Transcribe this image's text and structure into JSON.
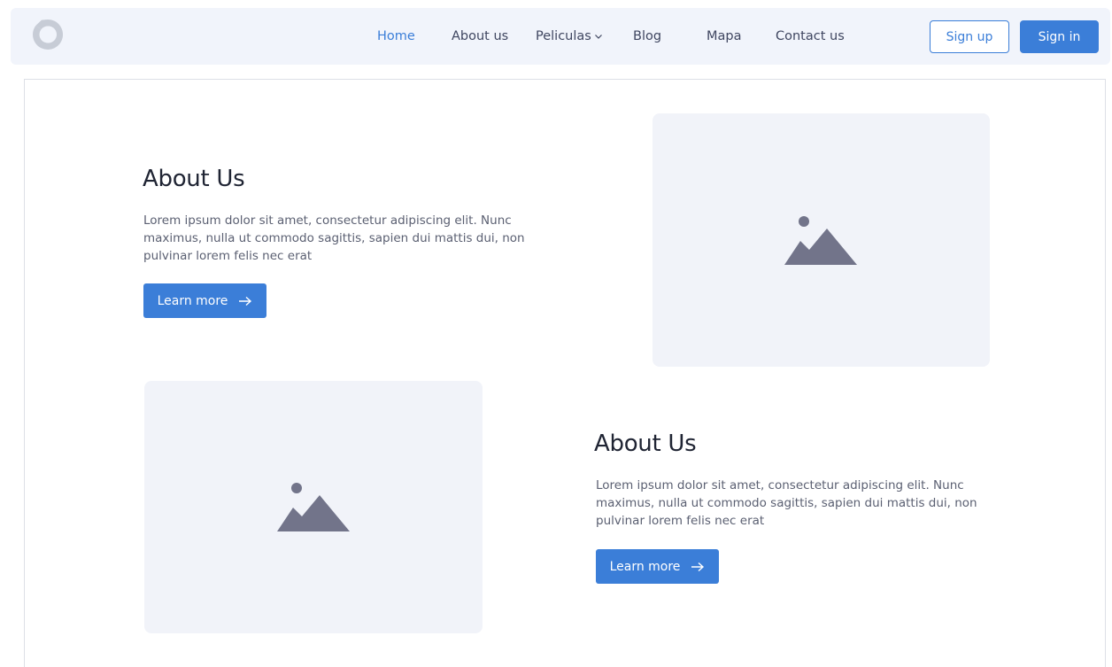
{
  "nav": {
    "links": [
      {
        "label": "Home",
        "active": true
      },
      {
        "label": "About us"
      },
      {
        "label": "Peliculas",
        "dropdown": true
      },
      {
        "label": "Blog"
      },
      {
        "label": "Mapa"
      },
      {
        "label": "Contact us"
      }
    ],
    "signup_label": "Sign up",
    "signin_label": "Sign in"
  },
  "sections": [
    {
      "title": "About Us",
      "body": "Lorem ipsum dolor sit amet, consectetur adipiscing elit. Nunc maximus, nulla ut commodo sagittis, sapien dui mattis dui, non pulvinar lorem felis nec erat",
      "button_label": "Learn more"
    },
    {
      "title": "About Us",
      "body": "Lorem ipsum dolor sit amet, consectetur adipiscing elit. Nunc maximus, nulla ut commodo sagittis, sapien dui mattis dui, non pulvinar lorem felis nec erat",
      "button_label": "Learn more"
    }
  ],
  "colors": {
    "accent": "#3b7ed8",
    "nav_bg": "#f1f4fb",
    "placeholder_bg": "#f1f3f9",
    "placeholder_icon": "#72748a",
    "logo": "#c7ccd6"
  },
  "icons": {
    "logo": "logo-ring-icon",
    "dropdown": "chevron-down-icon",
    "arrow": "arrow-right-icon",
    "image": "image-placeholder-icon"
  }
}
